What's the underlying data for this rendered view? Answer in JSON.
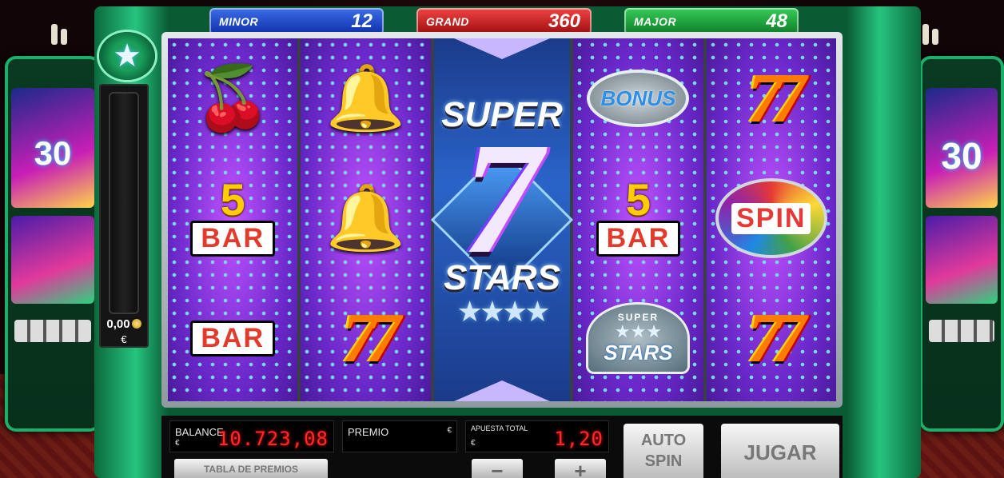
{
  "jackpots": {
    "minor": {
      "label": "MINOR",
      "value": "12"
    },
    "grand": {
      "label": "GRAND",
      "value": "360"
    },
    "major": {
      "label": "MAJOR",
      "value": "48"
    }
  },
  "meter": {
    "value": "0,00",
    "currency": "€"
  },
  "side_machines": {
    "left_number": "30",
    "right_number": "30"
  },
  "reels": {
    "center_logo": {
      "top": "SUPER",
      "digit": "7",
      "bottom": "STARS"
    },
    "symbols": {
      "reel1": [
        "cherries",
        "5 BAR",
        "BAR"
      ],
      "reel2": [
        "bell",
        "bell",
        "777"
      ],
      "reel4": [
        "BONUS",
        "5 BAR",
        "SUPER STARS"
      ],
      "reel5": [
        "777",
        "SPIN",
        "777"
      ]
    },
    "labels": {
      "five": "5",
      "bar": "BAR",
      "bonus": "BONUS",
      "spin": "SPIN",
      "super": "SUPER",
      "stars": "STARS",
      "seven": "77"
    }
  },
  "panel": {
    "balance_label": "BALANCE",
    "balance_currency": "€",
    "balance_value": "10.723,08",
    "premio_label": "PREMIO",
    "premio_currency": "€",
    "apuesta_label": "APUESTA TOTAL",
    "apuesta_currency": "€",
    "apuesta_value": "1,20",
    "tabla_button": "TABLA DE PREMIOS",
    "minus_button": "−",
    "plus_button": "+",
    "auto_line1": "AUTO",
    "auto_line2": "SPIN",
    "jugar_button": "JUGAR"
  },
  "colors": {
    "minor": "#0b2ea8",
    "grand": "#9c0b0b",
    "major": "#0b7a24",
    "digital": "#ff2a2a"
  }
}
